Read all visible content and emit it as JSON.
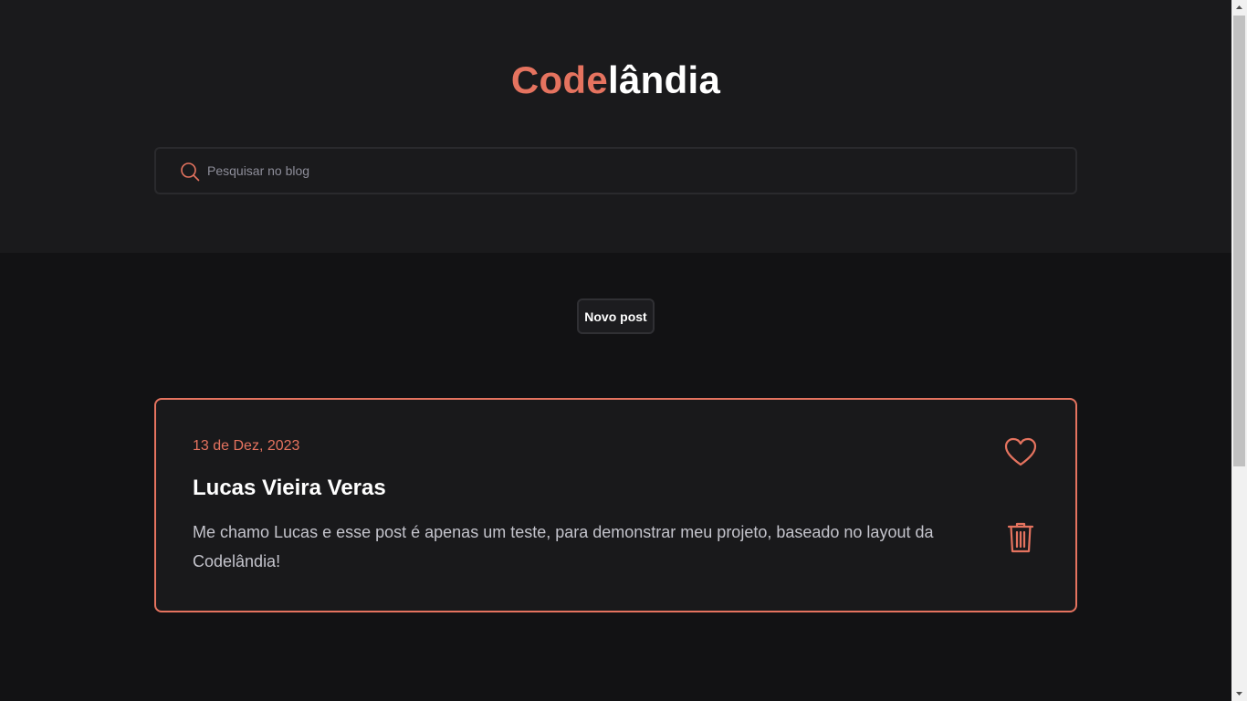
{
  "header": {
    "logo_accent": "Code",
    "logo_rest": "lândia"
  },
  "search": {
    "placeholder": "Pesquisar no blog",
    "value": ""
  },
  "actions": {
    "new_post_label": "Novo post"
  },
  "posts": [
    {
      "date": "13 de Dez, 2023",
      "title": "Lucas Vieira Veras",
      "body": "Me chamo Lucas e esse post é apenas um teste, para demonstrar meu projeto, baseado no layout da Codelândia!",
      "icons": [
        "heart-icon",
        "trash-icon"
      ]
    }
  ],
  "colors": {
    "accent": "#e5735f",
    "background": "#121214",
    "header_background": "#1a1a1c",
    "text_muted": "#c4c4cc"
  }
}
